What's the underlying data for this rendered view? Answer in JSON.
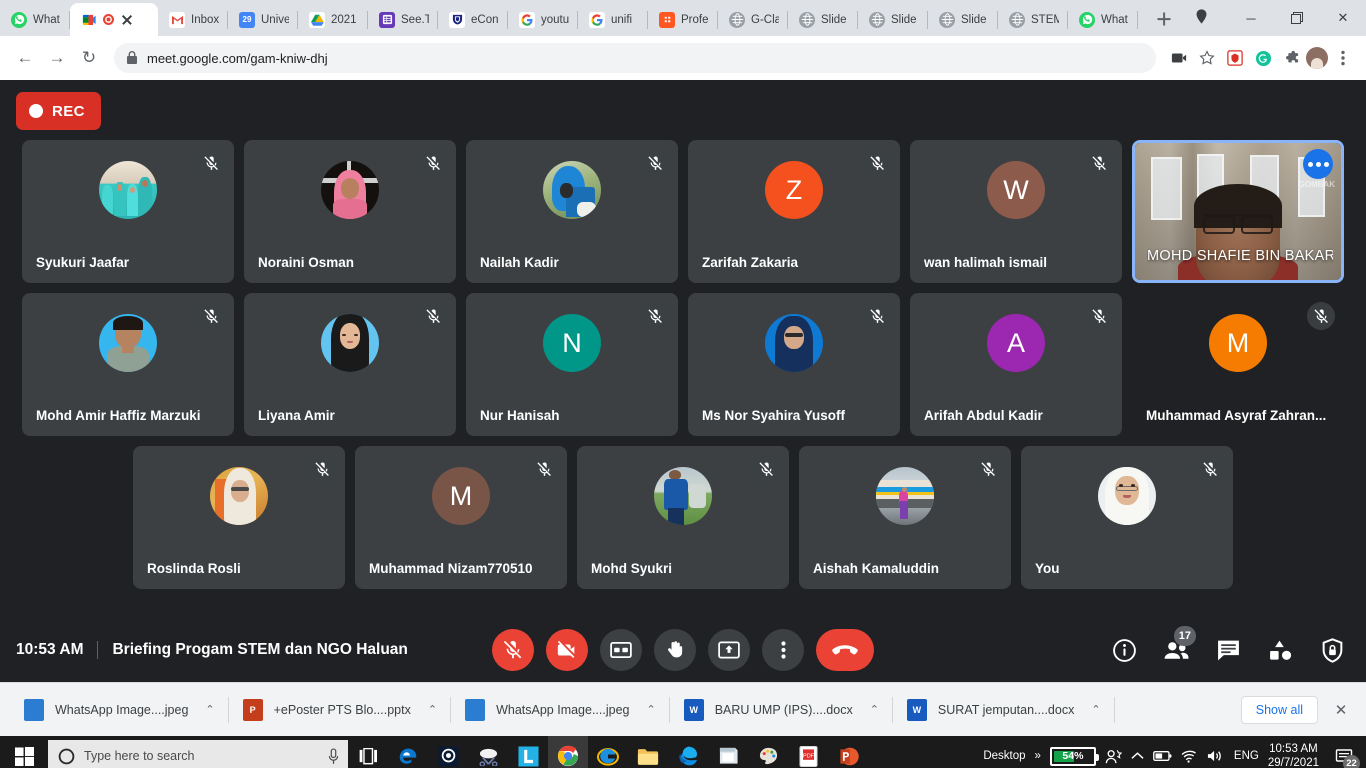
{
  "browser": {
    "tabs": [
      {
        "title": "What",
        "favicon": "whatsapp-icon",
        "active": false
      },
      {
        "title": "",
        "favicon": "google-meet-icon",
        "active": true,
        "recording": true
      },
      {
        "title": "Inbox",
        "favicon": "gmail-icon",
        "active": false
      },
      {
        "title": "Unive",
        "favicon": "google-calendar-icon",
        "active": false
      },
      {
        "title": "2021",
        "favicon": "google-drive-icon",
        "active": false
      },
      {
        "title": "See.T",
        "favicon": "seesaw-icon",
        "active": false
      },
      {
        "title": "eCon",
        "favicon": "econ-icon",
        "active": false
      },
      {
        "title": "youtu",
        "favicon": "google-icon",
        "active": false
      },
      {
        "title": "unifi",
        "favicon": "google-icon",
        "active": false
      },
      {
        "title": "Profe",
        "favicon": "profile-icon",
        "active": false
      },
      {
        "title": "G-Cla",
        "favicon": "globe-icon",
        "active": false
      },
      {
        "title": "Slide",
        "favicon": "globe-icon",
        "active": false
      },
      {
        "title": "Slide",
        "favicon": "globe-icon",
        "active": false
      },
      {
        "title": "Slide",
        "favicon": "globe-icon",
        "active": false
      },
      {
        "title": "STEM",
        "favicon": "globe-icon",
        "active": false
      },
      {
        "title": "What",
        "favicon": "whatsapp-icon",
        "active": false
      }
    ],
    "new_tab_label": "+",
    "window_controls": {
      "minimize": "─",
      "maximize": "❐",
      "close": "✕"
    },
    "url": "meet.google.com/gam-kniw-dhj",
    "nav": {
      "back": "←",
      "forward": "→",
      "reload": "↻"
    }
  },
  "meet": {
    "recording_label": "REC",
    "time": "10:53 AM",
    "meeting_title": "Briefing Progam STEM dan NGO Haluan",
    "participant_count": "17",
    "rows": [
      [
        {
          "name": "Syukuri Jaafar",
          "type": "photo",
          "photo": "family-teal",
          "muted": true
        },
        {
          "name": "Noraini Osman",
          "type": "photo",
          "photo": "pink-hijab",
          "muted": true
        },
        {
          "name": "Nailah Kadir",
          "type": "photo",
          "photo": "blue-hijab",
          "muted": true
        },
        {
          "name": "Zarifah Zakaria",
          "type": "initial",
          "initial": "Z",
          "color": "#f4511e",
          "muted": true
        },
        {
          "name": "wan halimah ismail",
          "type": "initial",
          "initial": "W",
          "color": "#8d5b4c",
          "muted": true
        },
        {
          "name": "MOHD SHAFIE BIN BAKAR",
          "type": "video",
          "muted": false,
          "speaking": true,
          "logo": "GOMBAK"
        }
      ],
      [
        {
          "name": "Mohd Amir Haffiz Marzuki",
          "type": "photo",
          "photo": "man-blue",
          "muted": true
        },
        {
          "name": "Liyana Amir",
          "type": "photo",
          "photo": "black-hijab",
          "muted": true
        },
        {
          "name": "Nur Hanisah",
          "type": "initial",
          "initial": "N",
          "color": "#009688",
          "muted": true
        },
        {
          "name": "Ms Nor Syahira Yusoff",
          "type": "photo",
          "photo": "navy-hijab",
          "muted": true
        },
        {
          "name": "Arifah Abdul Kadir",
          "type": "initial",
          "initial": "A",
          "color": "#9c27b0",
          "muted": true
        },
        {
          "name": "Muhammad Asyraf Zahran...",
          "type": "initial",
          "initial": "M",
          "color": "#f57c00",
          "muted": true,
          "no_card": true
        }
      ],
      [
        {
          "name": "Roslinda Rosli",
          "type": "photo",
          "photo": "gold-hijab",
          "muted": true
        },
        {
          "name": "Muhammad Nizam770510",
          "type": "initial",
          "initial": "M",
          "color": "#795548",
          "muted": true
        },
        {
          "name": "Mohd Syukri",
          "type": "photo",
          "photo": "man-outdoor",
          "muted": true
        },
        {
          "name": "Aishah Kamaluddin",
          "type": "photo",
          "photo": "train-scene",
          "muted": true
        },
        {
          "name": "You",
          "type": "photo",
          "photo": "white-hijab",
          "muted": true
        }
      ]
    ],
    "controls": [
      {
        "name": "microphone-off-button",
        "icon": "mic-off-icon",
        "state": "red"
      },
      {
        "name": "camera-off-button",
        "icon": "camera-off-icon",
        "state": "red"
      },
      {
        "name": "captions-button",
        "icon": "cc-icon",
        "state": "grey"
      },
      {
        "name": "raise-hand-button",
        "icon": "hand-icon",
        "state": "grey"
      },
      {
        "name": "present-now-button",
        "icon": "present-icon",
        "state": "grey"
      },
      {
        "name": "more-options-button",
        "icon": "more-vertical-icon",
        "state": "grey"
      },
      {
        "name": "leave-call-button",
        "icon": "hangup-icon",
        "state": "red"
      }
    ],
    "right_controls": [
      {
        "name": "meeting-details-button",
        "icon": "info-icon"
      },
      {
        "name": "show-everyone-button",
        "icon": "people-icon",
        "badge": "17"
      },
      {
        "name": "chat-button",
        "icon": "chat-icon"
      },
      {
        "name": "activities-button",
        "icon": "activities-icon"
      },
      {
        "name": "host-controls-button",
        "icon": "shield-lock-icon"
      }
    ]
  },
  "downloads": {
    "items": [
      {
        "name": "WhatsApp Image....jpeg",
        "type": "jpeg",
        "color": "#2a7dd1"
      },
      {
        "name": "+ePoster PTS Blo....pptx",
        "type": "pptx",
        "color": "#c43e1c"
      },
      {
        "name": "WhatsApp Image....jpeg",
        "type": "jpeg",
        "color": "#2a7dd1"
      },
      {
        "name": "BARU UMP (IPS)....docx",
        "type": "docx",
        "color": "#185abd"
      },
      {
        "name": "SURAT jemputan....docx",
        "type": "docx",
        "color": "#185abd"
      }
    ],
    "show_all_label": "Show all",
    "close_label": "✕",
    "caret": "⌃"
  },
  "taskbar": {
    "search_placeholder": "Type here to search",
    "apps": [
      {
        "name": "task-view-icon",
        "running": false
      },
      {
        "name": "microsoft-edge-legacy-icon",
        "running": false
      },
      {
        "name": "obs-studio-icon",
        "running": true
      },
      {
        "name": "snipping-tool-icon",
        "running": false
      },
      {
        "name": "lightshot-icon",
        "running": true
      },
      {
        "name": "google-chrome-icon",
        "running": true,
        "active": true
      },
      {
        "name": "internet-explorer-icon",
        "running": false
      },
      {
        "name": "file-explorer-icon",
        "running": true
      },
      {
        "name": "microsoft-edge-icon",
        "running": true
      },
      {
        "name": "sticky-notes-icon",
        "running": true
      },
      {
        "name": "paint-icon",
        "running": true
      },
      {
        "name": "adobe-reader-icon",
        "running": true
      },
      {
        "name": "powerpoint-icon",
        "running": true
      }
    ],
    "tray": {
      "desktop_label": "Desktop",
      "overflow": "»",
      "battery_percent": "54%",
      "battery_level": 54,
      "language": "ENG",
      "time": "10:53 AM",
      "date": "29/7/2021",
      "notification_count": "22"
    }
  }
}
